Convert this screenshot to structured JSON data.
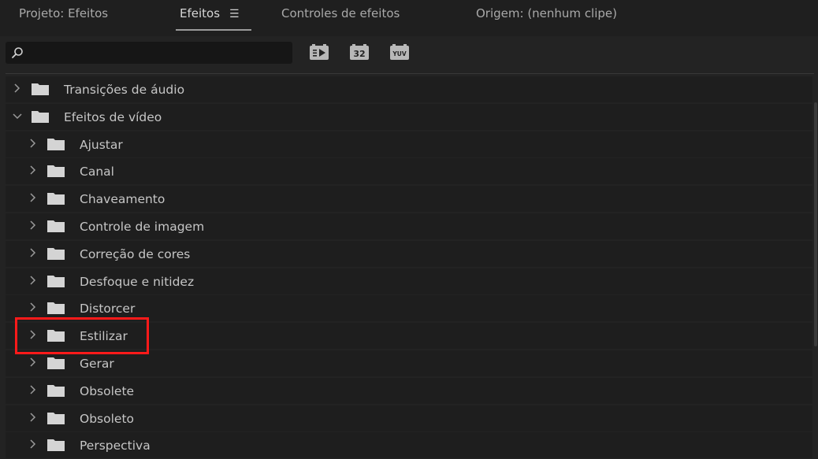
{
  "tabs": [
    {
      "label": "Projeto: Efeitos"
    },
    {
      "label": "Efeitos"
    },
    {
      "label": "Controles de efeitos"
    },
    {
      "label": "Origem: (nenhum clipe)"
    }
  ],
  "active_tab_menu_icon": "hamburger-menu-icon",
  "search": {
    "value": "",
    "placeholder": ""
  },
  "toolbar": {
    "accelerated": {
      "icon": "accelerated-effects-icon"
    },
    "bit32": {
      "text": "32"
    },
    "yuv": {
      "text": "YUV"
    }
  },
  "tree": [
    {
      "label": "Transições de áudio",
      "level": 0,
      "expanded": false
    },
    {
      "label": "Efeitos de vídeo",
      "level": 0,
      "expanded": true
    },
    {
      "label": "Ajustar",
      "level": 1,
      "expanded": false
    },
    {
      "label": "Canal",
      "level": 1,
      "expanded": false
    },
    {
      "label": "Chaveamento",
      "level": 1,
      "expanded": false
    },
    {
      "label": "Controle de imagem",
      "level": 1,
      "expanded": false
    },
    {
      "label": "Correção de cores",
      "level": 1,
      "expanded": false
    },
    {
      "label": "Desfoque e nitidez",
      "level": 1,
      "expanded": false
    },
    {
      "label": "Distorcer",
      "level": 1,
      "expanded": false
    },
    {
      "label": "Estilizar",
      "level": 1,
      "expanded": false,
      "highlighted": true
    },
    {
      "label": "Gerar",
      "level": 1,
      "expanded": false
    },
    {
      "label": "Obsolete",
      "level": 1,
      "expanded": false
    },
    {
      "label": "Obsoleto",
      "level": 1,
      "expanded": false
    },
    {
      "label": "Perspectiva",
      "level": 1,
      "expanded": false
    }
  ],
  "colors": {
    "highlight": "#ff1a1a",
    "background": "#232323"
  }
}
